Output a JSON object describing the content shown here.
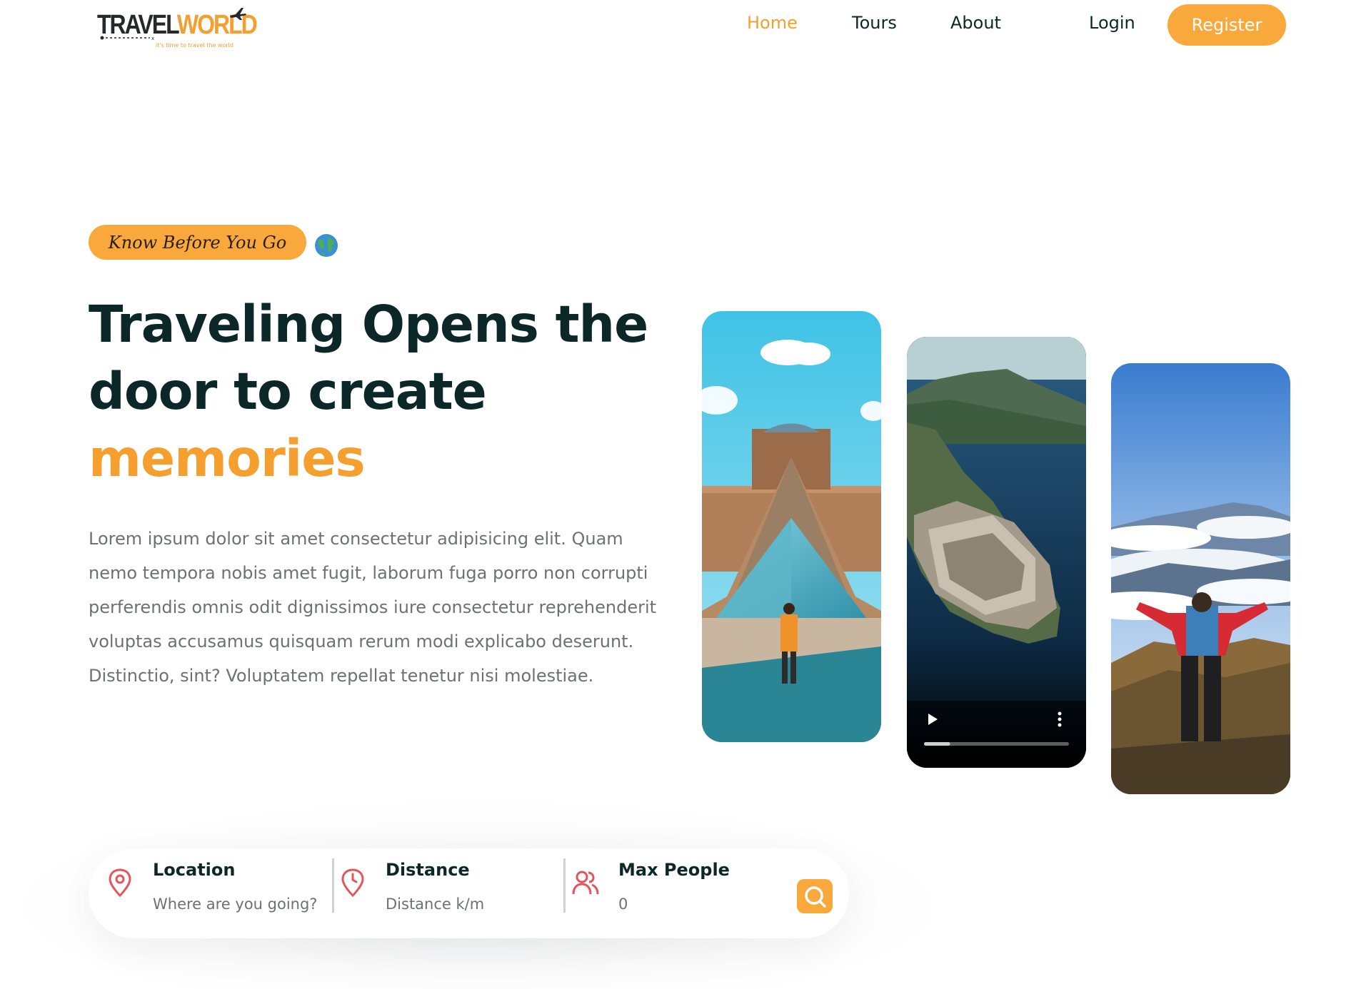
{
  "brand": {
    "logo_text_dark": "TRAVEL",
    "logo_text_accent": "WORLD",
    "tagline": "it's time to travel the world"
  },
  "nav": {
    "items": [
      {
        "label": "Home",
        "active": true
      },
      {
        "label": "Tours",
        "active": false
      },
      {
        "label": "About",
        "active": false
      }
    ],
    "login_label": "Login",
    "register_label": "Register"
  },
  "hero": {
    "badge_text": "Know Before You Go",
    "badge_icon": "globe-icon",
    "title_line1": "Traveling Opens the",
    "title_line2": "door to create",
    "title_highlight": "memories",
    "description": "Lorem ipsum dolor sit amet consectetur adipisicing elit. Quam nemo tempora nobis amet fugit, laborum fuga porro non corrupti perferendis omnis odit dignissimos iure consectetur reprehenderit voluptas accusamus quisquam rerum modi explicabo deserunt. Distinctio, sint? Voluptatem repellat tenetur nisi molestiae.",
    "video_progress_fraction": 0.18
  },
  "search": {
    "location": {
      "label": "Location",
      "placeholder": "Where are you going?",
      "icon": "map-pin-icon"
    },
    "distance": {
      "label": "Distance",
      "placeholder": "Distance k/m",
      "icon": "map-pin-clock-icon"
    },
    "people": {
      "label": "Max People",
      "placeholder": "0",
      "icon": "users-icon"
    },
    "button_icon": "search-icon"
  },
  "colors": {
    "accent": "#f9a83b",
    "heading": "#0b2727",
    "text": "#6e7074",
    "icon": "#e4545b"
  }
}
